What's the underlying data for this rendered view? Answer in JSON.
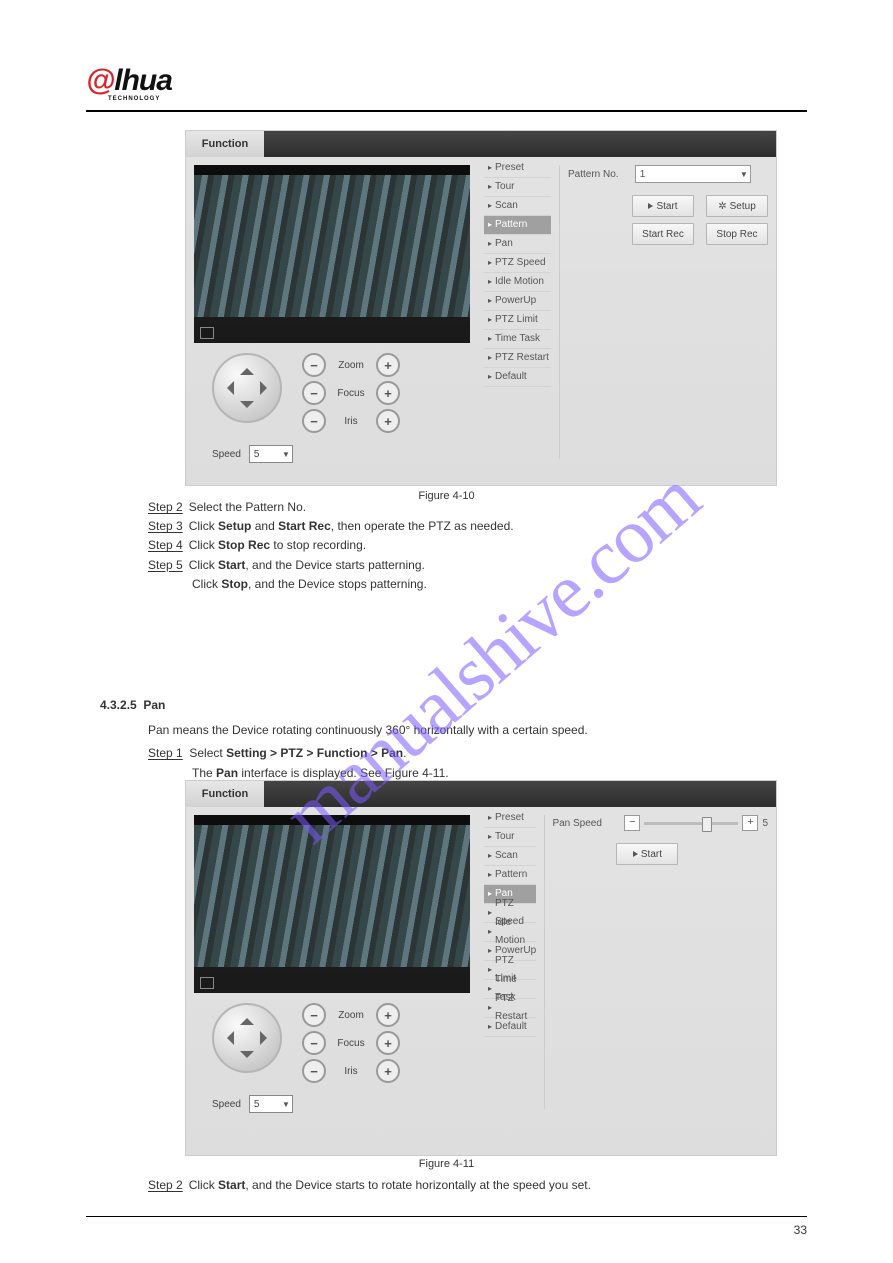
{
  "brand": {
    "prefix": "@",
    "name": "lhua",
    "sub": "TECHNOLOGY"
  },
  "watermark": "manualshive.com",
  "figure1_caption": "Figure 4-10",
  "figure2_caption": "Figure 4-11",
  "function_tab": "Function",
  "menu": {
    "items": [
      "Preset",
      "Tour",
      "Scan",
      "Pattern",
      "Pan",
      "PTZ Speed",
      "Idle Motion",
      "PowerUp",
      "PTZ Limit",
      "Time Task",
      "PTZ Restart",
      "Default"
    ],
    "selected_fig1": "Pattern",
    "selected_fig2": "Pan"
  },
  "ptz": {
    "zoom": "Zoom",
    "focus": "Focus",
    "iris": "Iris",
    "speed_label": "Speed",
    "speed_value": "5"
  },
  "pattern": {
    "label": "Pattern No.",
    "value": "1",
    "start": "Start",
    "setup": "Setup",
    "start_rec": "Start Rec",
    "stop_rec": "Stop Rec"
  },
  "pan": {
    "label": "Pan Speed",
    "value": "5",
    "start": "Start"
  },
  "text": {
    "step2": "Step 2",
    "step2_body": "Select the Pattern No.",
    "step3": "Step 3",
    "step3_a": "Click ",
    "step3_b": "Setup",
    "step3_c": " and ",
    "step3_d": "Start Rec",
    "step3_e": ", then operate the PTZ as needed.",
    "step4": "Step 4",
    "step4_a": "Click ",
    "step4_b": "Stop Rec",
    "step4_c": " to stop recording.",
    "step5": "Step 5",
    "step5_a": "Click ",
    "step5_b": "Start",
    "step5_c": ", and the Device starts patterning.",
    "step5_d": "Click ",
    "step5_e": "Stop",
    "step5_f": ", and the Device stops patterning.",
    "sec_no": "4.3.2.5",
    "sec_title": "Pan",
    "sec_body": "Pan means the Device rotating continuously 360° horizontally with a certain speed.",
    "pan_step1": "Step 1",
    "pan_step1_a": "Select ",
    "pan_step1_b": "Setting > PTZ > Function > Pan",
    "pan_step1_c": ".",
    "pan_step1_d": "The ",
    "pan_step1_e": "Pan",
    "pan_step1_f": " interface is displayed. See Figure 4-11.",
    "pan_step2_num": "Step 2",
    "pan_step2_a": "Click ",
    "pan_step2_b": "Start",
    "pan_step2_c": ", and the Device starts to rotate horizontally at the speed you set."
  },
  "pagenum": "33"
}
